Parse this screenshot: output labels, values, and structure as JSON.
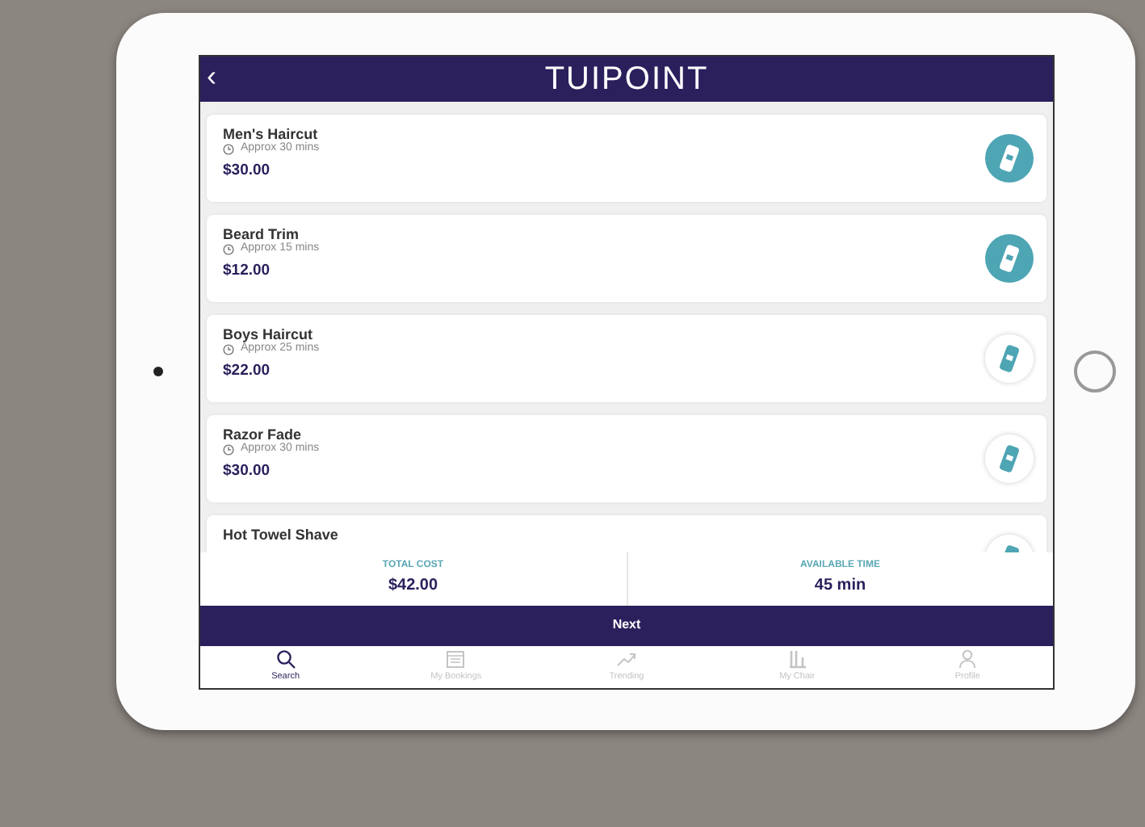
{
  "header": {
    "back": "‹",
    "title": "TUIPOINT"
  },
  "services": [
    {
      "name": "Men's Haircut",
      "duration": "Approx 30 mins",
      "price": "$30.00",
      "selected": true
    },
    {
      "name": "Beard Trim",
      "duration": "Approx 15 mins",
      "price": "$12.00",
      "selected": true
    },
    {
      "name": "Boys Haircut",
      "duration": "Approx 25 mins",
      "price": "$22.00",
      "selected": false
    },
    {
      "name": "Razor Fade",
      "duration": "Approx 30 mins",
      "price": "$30.00",
      "selected": false
    },
    {
      "name": "Hot Towel Shave",
      "selected": false
    }
  ],
  "summary": [
    {
      "label": "TOTAL COST",
      "value": "$42.00"
    },
    {
      "label": "AVAILABLE TIME",
      "value": "45 min"
    }
  ],
  "next_button": "Next",
  "tab_bar": [
    {
      "label": "Search",
      "kind": "search",
      "selected": true
    },
    {
      "label": "My Bookings",
      "kind": "calendar",
      "selected": false
    },
    {
      "label": "Trending",
      "kind": "trend",
      "selected": false
    },
    {
      "label": "My Chair",
      "kind": "chair",
      "selected": false
    },
    {
      "label": "Profile",
      "kind": "person",
      "selected": false
    }
  ]
}
